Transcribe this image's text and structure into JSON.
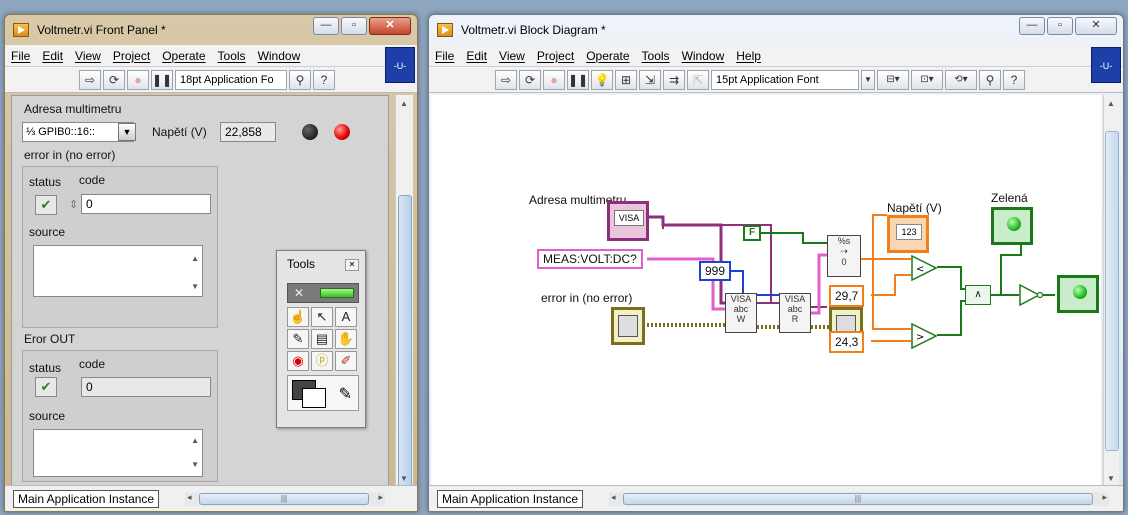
{
  "front_panel": {
    "title": "Voltmetr.vi Front Panel *",
    "menu": [
      "File",
      "Edit",
      "View",
      "Project",
      "Operate",
      "Tools",
      "Window"
    ],
    "font_selector": "18pt Application Fo",
    "instance_badge": "-U-",
    "controls": {
      "address_label": "Adresa multimetru",
      "address_value": "GPIB0::16::",
      "voltage_label": "Napětí (V)",
      "voltage_value": "22,858",
      "error_in_label": "error in (no error)",
      "status_label": "status",
      "code_label": "code",
      "error_in_code": "0",
      "source_label": "source",
      "error_out_label": "Eror OUT",
      "error_out_status_label": "status",
      "error_out_code_label": "code",
      "error_out_code": "0",
      "error_out_source_label": "source"
    },
    "tools_palette": {
      "title": "Tools"
    },
    "bottom": {
      "instance_label": "Main Application Instance"
    }
  },
  "block_diagram": {
    "title": "Voltmetr.vi Block Diagram *",
    "menu": [
      "File",
      "Edit",
      "View",
      "Project",
      "Operate",
      "Tools",
      "Window",
      "Help"
    ],
    "font_selector": "15pt Application Font",
    "instance_badge": "-U-",
    "labels": {
      "address": "Adresa multimetru",
      "error_in": "error in (no error)",
      "voltage": "Napětí  (V)",
      "green": "Zelená"
    },
    "constants": {
      "command": "MEAS:VOLT:DC?",
      "byte_count": "999",
      "upper_limit": "29,7",
      "lower_limit": "24,3",
      "bool_const": "F",
      "visa_text": "VISA",
      "num_indicator": "123"
    },
    "bottom": {
      "instance_label": "Main Application Instance"
    }
  },
  "colors": {
    "string_wire": "#e25fcb",
    "numeric_int_wire": "#1f3fd6",
    "numeric_dbl_wire": "#f07f1c",
    "boolean_wire": "#1a7a1a",
    "visa_wire": "#8d2f7a",
    "error_wire": "#7a6f1e"
  }
}
